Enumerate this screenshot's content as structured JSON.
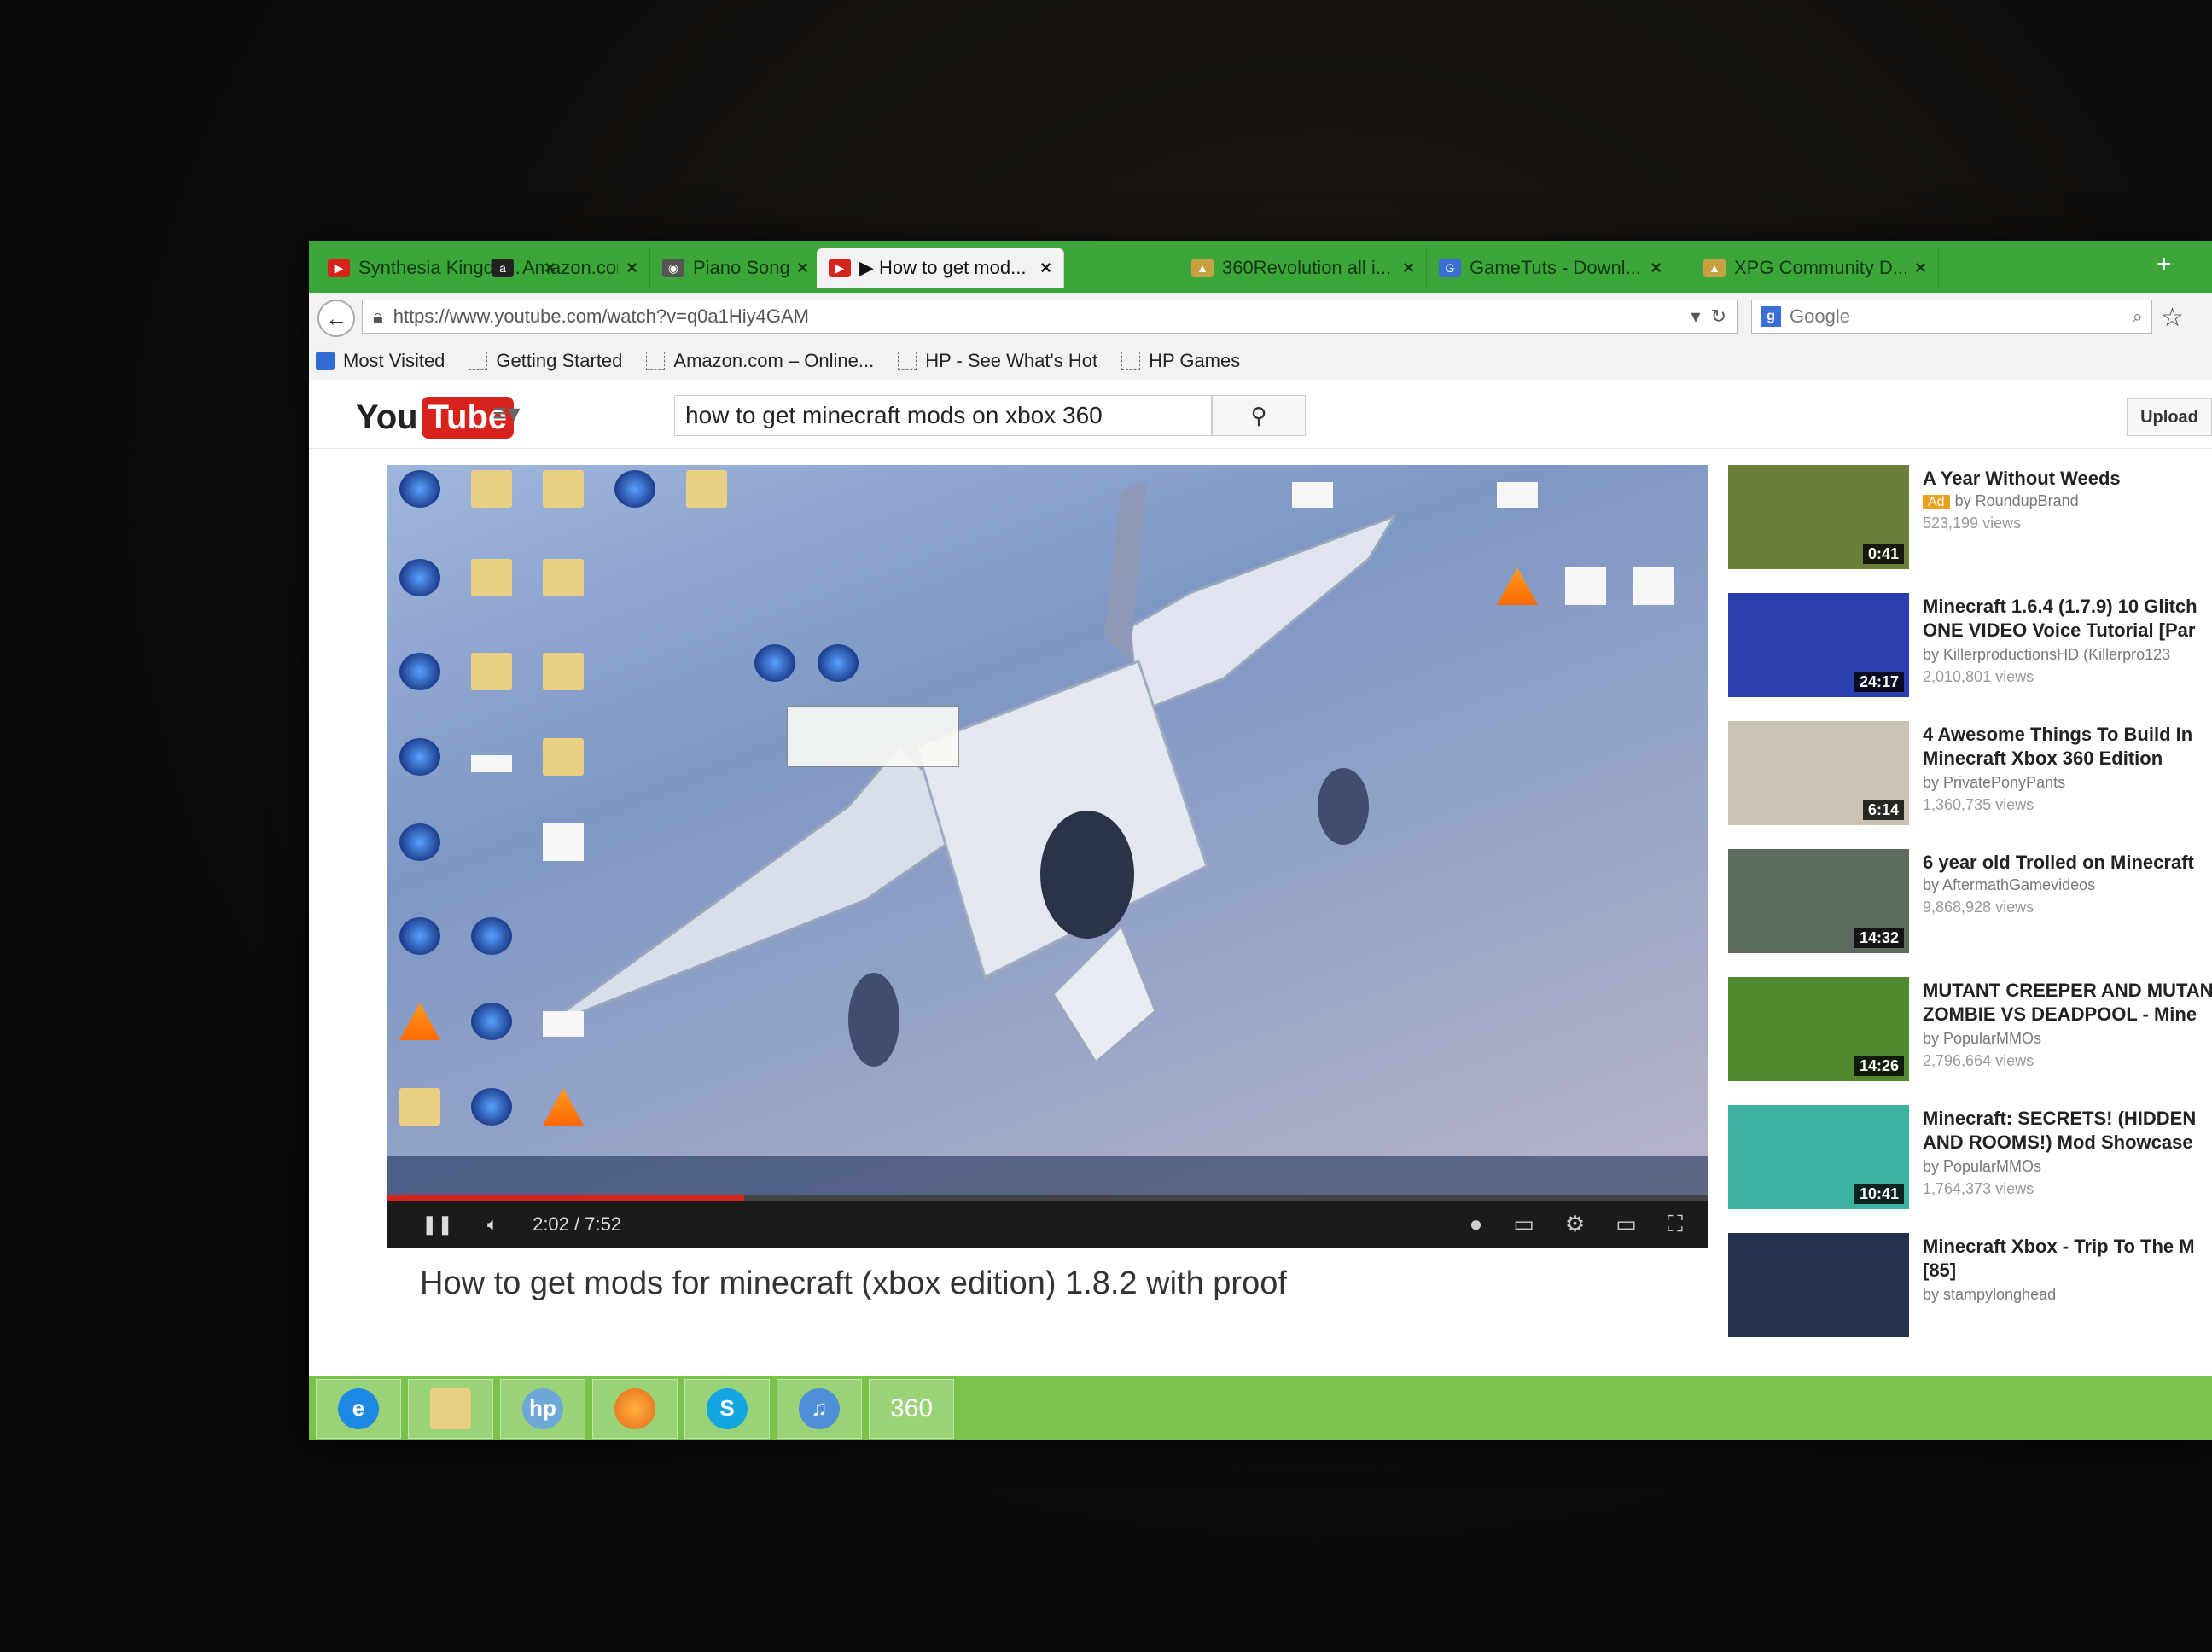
{
  "browser": {
    "tabs": [
      {
        "label": "Synthesia Kingdo...",
        "icon": "youtube-icon",
        "color": "#d8231c"
      },
      {
        "label": "Amazon.com : Ap...",
        "icon": "amazon-icon",
        "color": "#222222"
      },
      {
        "label": "Piano Songs - Pian...",
        "icon": "mask-icon",
        "color": "#555555"
      },
      {
        "label": "▶ How to get mod...",
        "icon": "youtube-icon",
        "color": "#d8231c",
        "active": true
      },
      {
        "label": "360Revolution all i...",
        "icon": "page-icon",
        "color": "#c8a040"
      },
      {
        "label": "GameTuts - Downl...",
        "icon": "g-icon",
        "color": "#3b6fd8"
      },
      {
        "label": "XPG Community D...",
        "icon": "page-icon",
        "color": "#c8a040"
      }
    ],
    "new_tab": "+",
    "url": "https://www.youtube.com/watch?v=q0a1Hiy4GAM",
    "search_engine": "Google",
    "bookmarks": [
      {
        "label": "Most Visited",
        "icon": "most-visited-icon"
      },
      {
        "label": "Getting Started",
        "icon": "bookmark-icon"
      },
      {
        "label": "Amazon.com – Online...",
        "icon": "bookmark-icon"
      },
      {
        "label": "HP - See What's Hot",
        "icon": "bookmark-icon"
      },
      {
        "label": "HP Games",
        "icon": "bookmark-icon"
      }
    ]
  },
  "youtube": {
    "logo_you": "You",
    "logo_tube": "Tube",
    "search_query": "how to get minecraft mods on xbox 360",
    "upload_label": "Upload",
    "brand_color": "#d8231c"
  },
  "player": {
    "time": "2:02 / 7:52",
    "progress_fraction": 0.27
  },
  "video": {
    "title": "How to get mods for minecraft (xbox edition) 1.8.2 with proof"
  },
  "sidebar": {
    "items": [
      {
        "title": "A Year Without Weeds",
        "ad": "Ad",
        "by": "by RoundupBrand",
        "views": "523,199 views",
        "duration": "0:41",
        "thumb_color": "#6b7f3a"
      },
      {
        "title": "Minecraft 1.6.4 (1.7.9) 10 Glitch",
        "title2": "ONE VIDEO Voice Tutorial [Par",
        "by": "by KillerproductionsHD (Killerpro123",
        "views": "2,010,801 views",
        "duration": "24:17",
        "thumb_color": "#2a3fb0"
      },
      {
        "title": "4 Awesome Things To Build In",
        "title2": "Minecraft Xbox 360 Edition",
        "by": "by PrivatePonyPants",
        "views": "1,360,735 views",
        "duration": "6:14",
        "thumb_color": "#c9c3b2"
      },
      {
        "title": "6 year old Trolled on Minecraft",
        "by": "by AftermathGamevideos",
        "views": "9,868,928 views",
        "duration": "14:32",
        "thumb_color": "#5d6b5f"
      },
      {
        "title": "MUTANT CREEPER AND MUTAN",
        "title2": "ZOMBIE VS DEADPOOL - Mine",
        "by": "by PopularMMOs",
        "views": "2,796,664 views",
        "duration": "14:26",
        "thumb_color": "#4f8a2f"
      },
      {
        "title": "Minecraft: SECRETS! (HIDDEN",
        "title2": "AND ROOMS!) Mod Showcase",
        "by": "by PopularMMOs",
        "views": "1,764,373 views",
        "duration": "10:41",
        "thumb_color": "#3bb3a0"
      },
      {
        "title": "Minecraft Xbox - Trip To The M",
        "title2": "[85]",
        "by": "by stampylonghead",
        "views": "",
        "duration": "",
        "thumb_color": "#23324d"
      }
    ]
  },
  "taskbar": {
    "items": [
      {
        "name": "internet-explorer-icon",
        "label": "e",
        "color": "#1e88e5"
      },
      {
        "name": "file-explorer-icon",
        "label": "",
        "color": "#e8cf84"
      },
      {
        "name": "hp-icon",
        "label": "hp",
        "color": "#6ea8d6"
      },
      {
        "name": "firefox-icon",
        "label": "",
        "color": "#e66a1f"
      },
      {
        "name": "skype-icon",
        "label": "S",
        "color": "#12a5e0"
      },
      {
        "name": "itunes-icon",
        "label": "♫",
        "color": "#4f8fd8"
      },
      {
        "name": "360-app-icon",
        "label": "360",
        "color": ""
      }
    ]
  }
}
